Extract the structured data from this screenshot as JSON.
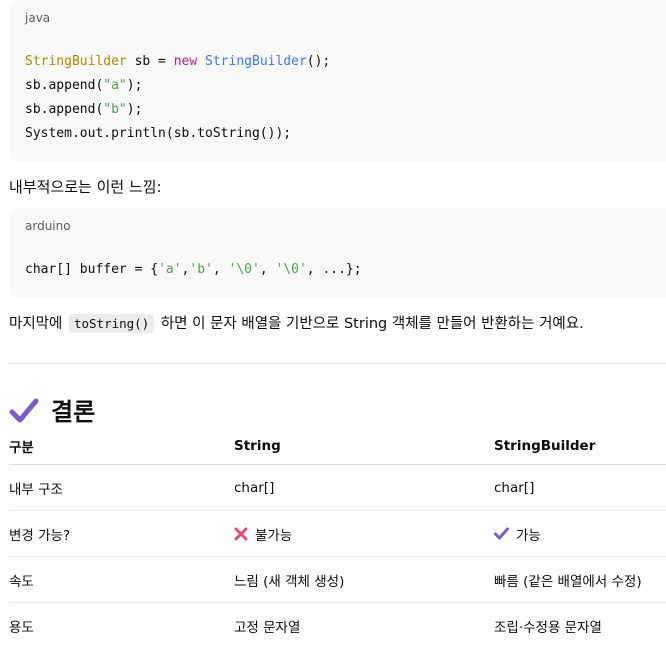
{
  "code1": {
    "lang": "java",
    "line1": {
      "type": "StringBuilder",
      "mid": " sb = ",
      "kw": "new",
      "sp": " ",
      "cls": "StringBuilder",
      "end": "();"
    },
    "line2": {
      "pre": "sb.append(",
      "str": "\"a\"",
      "post": ");"
    },
    "line3": {
      "pre": "sb.append(",
      "str": "\"b\"",
      "post": ");"
    },
    "line4": "System.out.println(sb.toString());"
  },
  "para1": "내부적으로는 이런 느낌:",
  "code2": {
    "lang": "arduino",
    "line1": {
      "pre": "char[] buffer = {",
      "a": "'a'",
      "c1": ",",
      "b": "'b'",
      "c2": ", ",
      "n1": "'\\0'",
      "c3": ", ",
      "n2": "'\\0'",
      "post": ", ...};"
    }
  },
  "para2": {
    "pre": "마지막에 ",
    "code": "toString()",
    "post": " 하면 이 문자 배열을 기반으로 String 객체를 만들어 반환하는 거예요."
  },
  "conclusion": {
    "title": "결론",
    "icon": "check-mark-icon",
    "accent": "#7b5cc8"
  },
  "table": {
    "headers": [
      "구분",
      "String",
      "StringBuilder"
    ],
    "rows": [
      {
        "label": "내부 구조",
        "string": "char[]",
        "builder": "char[]"
      },
      {
        "label": "변경 가능?",
        "string": "불가능",
        "string_icon": "cross-mark-icon",
        "builder": "가능",
        "builder_icon": "check-mark-icon"
      },
      {
        "label": "속도",
        "string": "느림 (새 객체 생성)",
        "builder": "빠름 (같은 배열에서 수정)"
      },
      {
        "label": "용도",
        "string": "고정 문자열",
        "builder": "조립·수정용 문자열"
      }
    ]
  },
  "colors": {
    "cross": "#e0506e",
    "check": "#7b5cc8"
  }
}
